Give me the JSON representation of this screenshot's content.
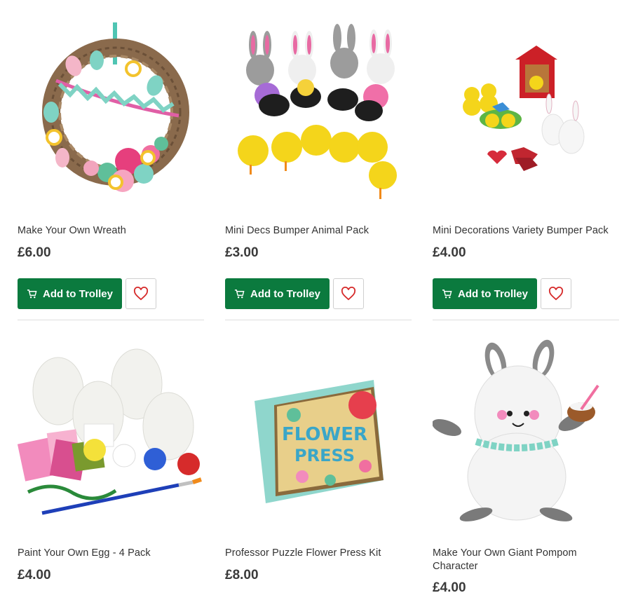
{
  "colors": {
    "primary_button": "#0b7a3e",
    "heart": "#d62b2b",
    "text": "#333333"
  },
  "buttons": {
    "add_to_trolley": "Add to Trolley",
    "trolley_icon": "trolley-icon",
    "wishlist_icon": "heart-icon"
  },
  "products": [
    {
      "title": "Make Your Own Wreath",
      "price": "£6.00",
      "image": "easter-wreath"
    },
    {
      "title": "Mini Decs Bumper Animal Pack",
      "price": "£3.00",
      "image": "bunnies-sheep-chicks"
    },
    {
      "title": "Mini Decorations Variety Bumper Pack",
      "price": "£4.00",
      "image": "mini-decorations"
    },
    {
      "title": "Paint Your Own Egg - 4 Pack",
      "price": "£4.00",
      "image": "paint-eggs-kit"
    },
    {
      "title": "Professor Puzzle Flower Press Kit",
      "price": "£8.00",
      "image": "flower-press-box",
      "box_text": "FLOWER PRESS"
    },
    {
      "title": "Make Your Own Giant Pompom Character",
      "price": "£4.00",
      "image": "pompom-bunny"
    }
  ]
}
